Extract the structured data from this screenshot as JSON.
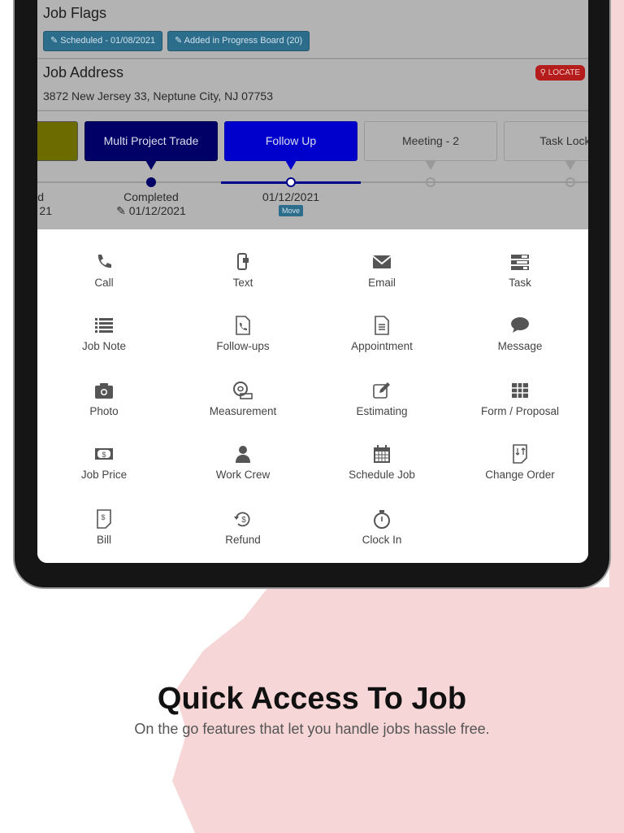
{
  "job_flags": {
    "title": "Job Flags",
    "flags": [
      "Scheduled - 01/08/2021",
      "Added in Progress Board (20)"
    ]
  },
  "job_address": {
    "title": "Job Address",
    "locate_label": "LOCATE",
    "address": "3872 New Jersey 33, Neptune City, NJ 07753"
  },
  "stages": [
    {
      "label": "",
      "color": "#6b6b00"
    },
    {
      "label": "Multi Project Trade",
      "color": "#000066",
      "status": "Completed",
      "date": "01/12/2021"
    },
    {
      "label": "Follow Up",
      "color": "#0000cc",
      "date": "01/12/2021",
      "move_label": "Move"
    },
    {
      "label": "Meeting - 2"
    },
    {
      "label": "Task Lock S"
    }
  ],
  "partial_stage_text": {
    "line1": "d",
    "line2": "21"
  },
  "actions": [
    {
      "label": "Call",
      "icon": "phone-icon"
    },
    {
      "label": "Text",
      "icon": "mobile-text-icon"
    },
    {
      "label": "Email",
      "icon": "envelope-icon"
    },
    {
      "label": "Task",
      "icon": "task-list-icon"
    },
    {
      "label": "Job Note",
      "icon": "list-icon"
    },
    {
      "label": "Follow-ups",
      "icon": "file-phone-icon"
    },
    {
      "label": "Appointment",
      "icon": "document-icon"
    },
    {
      "label": "Message",
      "icon": "chat-bubble-icon"
    },
    {
      "label": "Photo",
      "icon": "camera-icon"
    },
    {
      "label": "Measurement",
      "icon": "tape-measure-icon"
    },
    {
      "label": "Estimating",
      "icon": "edit-icon"
    },
    {
      "label": "Form / Proposal",
      "icon": "table-icon"
    },
    {
      "label": "Job Price",
      "icon": "money-icon"
    },
    {
      "label": "Work Crew",
      "icon": "user-icon"
    },
    {
      "label": "Schedule Job",
      "icon": "calendar-icon"
    },
    {
      "label": "Change Order",
      "icon": "file-swap-icon"
    },
    {
      "label": "Bill",
      "icon": "bill-icon"
    },
    {
      "label": "Refund",
      "icon": "refund-icon"
    },
    {
      "label": "Clock In",
      "icon": "stopwatch-icon"
    }
  ],
  "hero": {
    "title": "Quick Access To Job",
    "subtitle": "On the go features that let you handle jobs hassle free."
  },
  "colors": {
    "accent_pink": "#f6d6d6",
    "flag_blue": "#2d6d8c",
    "locate_red": "#b51d1d"
  }
}
